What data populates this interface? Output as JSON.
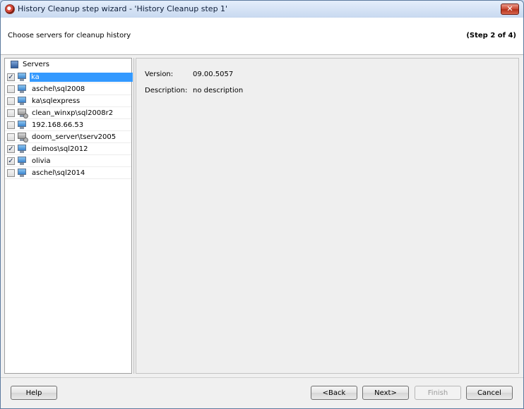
{
  "window": {
    "title": "History Cleanup step wizard - 'History Cleanup step 1'",
    "close_label": "✕"
  },
  "header": {
    "title": "Choose servers for cleanup history",
    "step": "(Step 2 of 4)"
  },
  "tree": {
    "root_label": "Servers",
    "items": [
      {
        "label": "ka",
        "checked": true,
        "icon": "server-online-icon",
        "selected": true
      },
      {
        "label": "aschel\\sql2008",
        "checked": false,
        "icon": "server-online-icon",
        "selected": false
      },
      {
        "label": "ka\\sqlexpress",
        "checked": false,
        "icon": "server-online-icon",
        "selected": false
      },
      {
        "label": "clean_winxp\\sql2008r2",
        "checked": false,
        "icon": "server-offline-icon",
        "selected": false
      },
      {
        "label": "192.168.66.53",
        "checked": false,
        "icon": "server-online-icon",
        "selected": false
      },
      {
        "label": "doom_server\\tserv2005",
        "checked": false,
        "icon": "server-offline-icon",
        "selected": false
      },
      {
        "label": "deimos\\sql2012",
        "checked": true,
        "icon": "server-online-icon",
        "selected": false
      },
      {
        "label": "olivia",
        "checked": true,
        "icon": "server-online-icon",
        "selected": false
      },
      {
        "label": "aschel\\sql2014",
        "checked": false,
        "icon": "server-online-icon",
        "selected": false
      }
    ]
  },
  "details": {
    "version_label": "Version:",
    "version_value": "09.00.5057",
    "description_label": "Description:",
    "description_value": "no description"
  },
  "buttons": {
    "help": "Help",
    "back": "<Back",
    "next": "Next>",
    "finish": "Finish",
    "cancel": "Cancel"
  }
}
